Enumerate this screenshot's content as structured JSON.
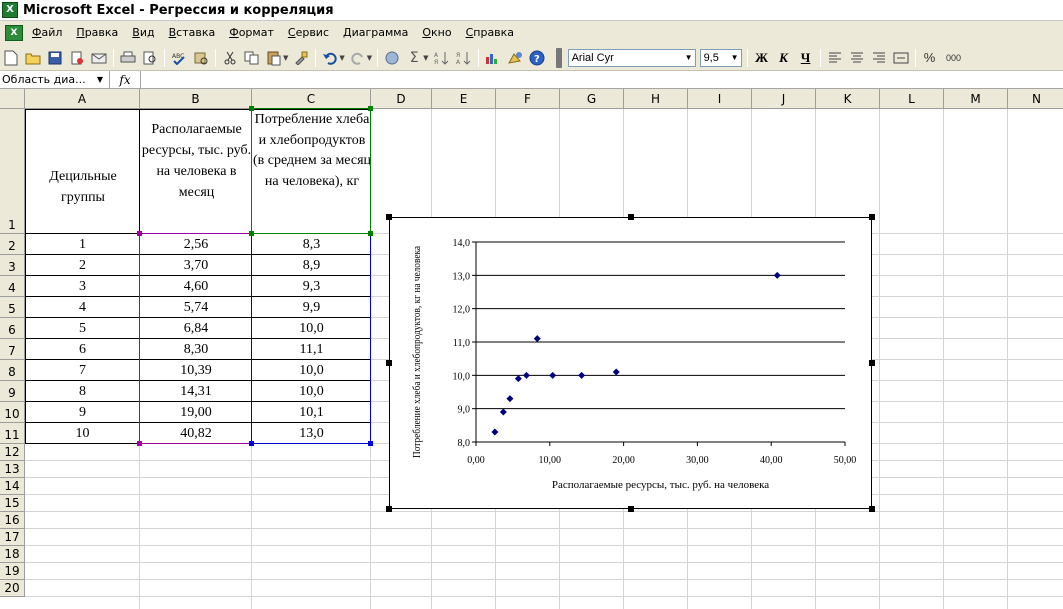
{
  "window": {
    "title": "Microsoft Excel - Регрессия и корреляция",
    "app_icon": "excel-icon"
  },
  "menu": [
    "Файл",
    "Правка",
    "Вид",
    "Вставка",
    "Формат",
    "Сервис",
    "Диаграмма",
    "Окно",
    "Справка"
  ],
  "toolbar": {
    "font_name": "Arial Cyr",
    "font_size": "9,5",
    "bold": "Ж",
    "italic": "К",
    "underline": "Ч",
    "percent": "%",
    "comma": "000"
  },
  "formula_bar": {
    "name_box": "Область диа...",
    "fx": "fx",
    "formula": ""
  },
  "columns": [
    "A",
    "B",
    "C",
    "D",
    "E",
    "F",
    "G",
    "H",
    "I",
    "J",
    "K",
    "L",
    "M",
    "N"
  ],
  "rows": [
    "1",
    "2",
    "3",
    "4",
    "5",
    "6",
    "7",
    "8",
    "9",
    "10",
    "11",
    "12",
    "13",
    "14",
    "15",
    "16",
    "17",
    "18",
    "19",
    "20"
  ],
  "sheet": {
    "header": {
      "a": "Децильные группы",
      "b": "Располагаемые ресурсы, тыс. руб. на человека в месяц",
      "c": "Потребление хлеба и хлебопродуктов (в среднем за месяц на человека), кг"
    },
    "data": [
      {
        "a": "1",
        "b": "2,56",
        "c": "8,3"
      },
      {
        "a": "2",
        "b": "3,70",
        "c": "8,9"
      },
      {
        "a": "3",
        "b": "4,60",
        "c": "9,3"
      },
      {
        "a": "4",
        "b": "5,74",
        "c": "9,9"
      },
      {
        "a": "5",
        "b": "6,84",
        "c": "10,0"
      },
      {
        "a": "6",
        "b": "8,30",
        "c": "11,1"
      },
      {
        "a": "7",
        "b": "10,39",
        "c": "10,0"
      },
      {
        "a": "8",
        "b": "14,31",
        "c": "10,0"
      },
      {
        "a": "9",
        "b": "19,00",
        "c": "10,1"
      },
      {
        "a": "10",
        "b": "40,82",
        "c": "13,0"
      }
    ]
  },
  "chart_data": {
    "type": "scatter",
    "title": "",
    "xlabel": "Располагаемые ресурсы, тыс. руб. на человека",
    "ylabel": "Потребление хлеба и хлебопродуктов, кг на человека",
    "xlim": [
      0,
      50
    ],
    "ylim": [
      8,
      14
    ],
    "x_ticks": [
      "0,00",
      "10,00",
      "20,00",
      "30,00",
      "40,00",
      "50,00"
    ],
    "y_ticks": [
      "8,0",
      "9,0",
      "10,0",
      "11,0",
      "12,0",
      "13,0",
      "14,0"
    ],
    "grid": "horizontal",
    "marker_color": "#000080",
    "series": [
      {
        "x": [
          2.56,
          3.7,
          4.6,
          5.74,
          6.84,
          8.3,
          10.39,
          14.31,
          19.0,
          40.82
        ],
        "y": [
          8.3,
          8.9,
          9.3,
          9.9,
          10.0,
          11.1,
          10.0,
          10.0,
          10.1,
          13.0
        ]
      }
    ]
  },
  "colors": {
    "toolbar_bg": "#ece9d8",
    "header_bg": "#ece9d8",
    "grid_line": "#d4d4d4",
    "range_b": "#a000a0",
    "range_c": "#0000e0",
    "range_header_c": "#008000"
  }
}
